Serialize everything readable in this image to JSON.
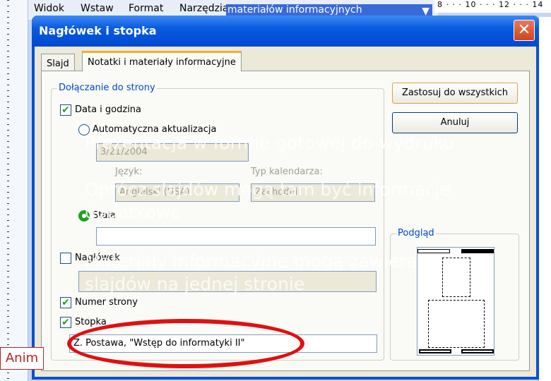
{
  "menu": {
    "items": [
      "Widok",
      "Wstaw",
      "Format",
      "Narzędzia"
    ],
    "combo_value": "materiałów informacyjnych",
    "ruler_top": "8 · · · 10 · · · 12 · · · 14"
  },
  "dialog": {
    "title": "Nagłówek i stopka",
    "tabs": [
      "Slajd",
      "Notatki i materiały informacyjne"
    ],
    "active_tab": 1,
    "group_label": "Dołączanie do strony",
    "date_time": {
      "label": "Data i godzina",
      "checked": true,
      "auto_label": "Automatyczna aktualizacja",
      "auto_value": "3/21/2004",
      "language_label": "Język:",
      "language_value": "Angielski (USA)",
      "calendar_label": "Typ kalendarza:",
      "calendar_value": "Zachodni",
      "fixed_label": "Stała",
      "fixed_value": ""
    },
    "header": {
      "label": "Nagłówek",
      "checked": false,
      "value": ""
    },
    "page_number": {
      "label": "Numer strony",
      "checked": true
    },
    "footer": {
      "label": "Stopka",
      "checked": true,
      "value": "Z. Postawa, \"Wstęp do informatyki II\""
    },
    "apply_all": "Zastosuj do wszystkich",
    "cancel": "Anuluj",
    "preview_label": "Podgląd"
  },
  "slide_overlay": [
    "Prezentacja w formie gotowej do wydruku",
    "Oprócz slajdów mogą tam być informacje",
    "dodatkowe",
    "Materiały informacyjne mogą zawierać",
    "slajdów na jednej stronie"
  ],
  "anim_label": "Anim"
}
